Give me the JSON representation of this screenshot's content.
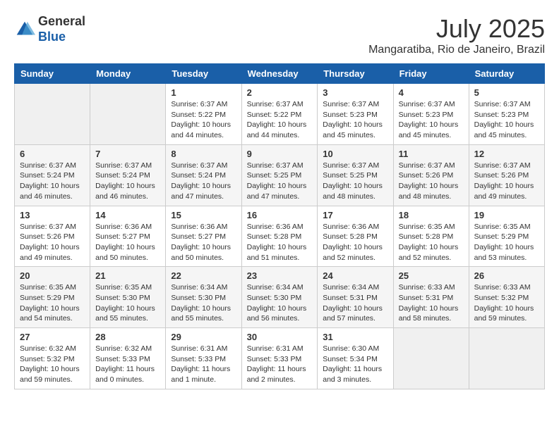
{
  "header": {
    "logo_general": "General",
    "logo_blue": "Blue",
    "month_title": "July 2025",
    "location": "Mangaratiba, Rio de Janeiro, Brazil"
  },
  "calendar": {
    "days_of_week": [
      "Sunday",
      "Monday",
      "Tuesday",
      "Wednesday",
      "Thursday",
      "Friday",
      "Saturday"
    ],
    "weeks": [
      [
        {
          "day": "",
          "info": ""
        },
        {
          "day": "",
          "info": ""
        },
        {
          "day": "1",
          "info": "Sunrise: 6:37 AM\nSunset: 5:22 PM\nDaylight: 10 hours and 44 minutes."
        },
        {
          "day": "2",
          "info": "Sunrise: 6:37 AM\nSunset: 5:22 PM\nDaylight: 10 hours and 44 minutes."
        },
        {
          "day": "3",
          "info": "Sunrise: 6:37 AM\nSunset: 5:23 PM\nDaylight: 10 hours and 45 minutes."
        },
        {
          "day": "4",
          "info": "Sunrise: 6:37 AM\nSunset: 5:23 PM\nDaylight: 10 hours and 45 minutes."
        },
        {
          "day": "5",
          "info": "Sunrise: 6:37 AM\nSunset: 5:23 PM\nDaylight: 10 hours and 45 minutes."
        }
      ],
      [
        {
          "day": "6",
          "info": "Sunrise: 6:37 AM\nSunset: 5:24 PM\nDaylight: 10 hours and 46 minutes."
        },
        {
          "day": "7",
          "info": "Sunrise: 6:37 AM\nSunset: 5:24 PM\nDaylight: 10 hours and 46 minutes."
        },
        {
          "day": "8",
          "info": "Sunrise: 6:37 AM\nSunset: 5:24 PM\nDaylight: 10 hours and 47 minutes."
        },
        {
          "day": "9",
          "info": "Sunrise: 6:37 AM\nSunset: 5:25 PM\nDaylight: 10 hours and 47 minutes."
        },
        {
          "day": "10",
          "info": "Sunrise: 6:37 AM\nSunset: 5:25 PM\nDaylight: 10 hours and 48 minutes."
        },
        {
          "day": "11",
          "info": "Sunrise: 6:37 AM\nSunset: 5:26 PM\nDaylight: 10 hours and 48 minutes."
        },
        {
          "day": "12",
          "info": "Sunrise: 6:37 AM\nSunset: 5:26 PM\nDaylight: 10 hours and 49 minutes."
        }
      ],
      [
        {
          "day": "13",
          "info": "Sunrise: 6:37 AM\nSunset: 5:26 PM\nDaylight: 10 hours and 49 minutes."
        },
        {
          "day": "14",
          "info": "Sunrise: 6:36 AM\nSunset: 5:27 PM\nDaylight: 10 hours and 50 minutes."
        },
        {
          "day": "15",
          "info": "Sunrise: 6:36 AM\nSunset: 5:27 PM\nDaylight: 10 hours and 50 minutes."
        },
        {
          "day": "16",
          "info": "Sunrise: 6:36 AM\nSunset: 5:28 PM\nDaylight: 10 hours and 51 minutes."
        },
        {
          "day": "17",
          "info": "Sunrise: 6:36 AM\nSunset: 5:28 PM\nDaylight: 10 hours and 52 minutes."
        },
        {
          "day": "18",
          "info": "Sunrise: 6:35 AM\nSunset: 5:28 PM\nDaylight: 10 hours and 52 minutes."
        },
        {
          "day": "19",
          "info": "Sunrise: 6:35 AM\nSunset: 5:29 PM\nDaylight: 10 hours and 53 minutes."
        }
      ],
      [
        {
          "day": "20",
          "info": "Sunrise: 6:35 AM\nSunset: 5:29 PM\nDaylight: 10 hours and 54 minutes."
        },
        {
          "day": "21",
          "info": "Sunrise: 6:35 AM\nSunset: 5:30 PM\nDaylight: 10 hours and 55 minutes."
        },
        {
          "day": "22",
          "info": "Sunrise: 6:34 AM\nSunset: 5:30 PM\nDaylight: 10 hours and 55 minutes."
        },
        {
          "day": "23",
          "info": "Sunrise: 6:34 AM\nSunset: 5:30 PM\nDaylight: 10 hours and 56 minutes."
        },
        {
          "day": "24",
          "info": "Sunrise: 6:34 AM\nSunset: 5:31 PM\nDaylight: 10 hours and 57 minutes."
        },
        {
          "day": "25",
          "info": "Sunrise: 6:33 AM\nSunset: 5:31 PM\nDaylight: 10 hours and 58 minutes."
        },
        {
          "day": "26",
          "info": "Sunrise: 6:33 AM\nSunset: 5:32 PM\nDaylight: 10 hours and 59 minutes."
        }
      ],
      [
        {
          "day": "27",
          "info": "Sunrise: 6:32 AM\nSunset: 5:32 PM\nDaylight: 10 hours and 59 minutes."
        },
        {
          "day": "28",
          "info": "Sunrise: 6:32 AM\nSunset: 5:33 PM\nDaylight: 11 hours and 0 minutes."
        },
        {
          "day": "29",
          "info": "Sunrise: 6:31 AM\nSunset: 5:33 PM\nDaylight: 11 hours and 1 minute."
        },
        {
          "day": "30",
          "info": "Sunrise: 6:31 AM\nSunset: 5:33 PM\nDaylight: 11 hours and 2 minutes."
        },
        {
          "day": "31",
          "info": "Sunrise: 6:30 AM\nSunset: 5:34 PM\nDaylight: 11 hours and 3 minutes."
        },
        {
          "day": "",
          "info": ""
        },
        {
          "day": "",
          "info": ""
        }
      ]
    ]
  }
}
